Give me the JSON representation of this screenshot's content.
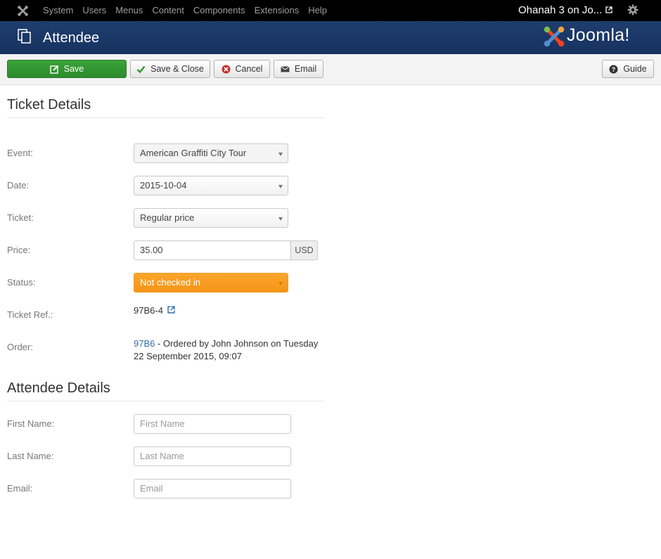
{
  "topnav": {
    "menu": [
      "System",
      "Users",
      "Menus",
      "Content",
      "Components",
      "Extensions",
      "Help"
    ],
    "site_name": "Ohanah 3 on Jo..."
  },
  "header": {
    "title": "Attendee",
    "brand": "Joomla!"
  },
  "toolbar": {
    "save": "Save",
    "save_close": "Save & Close",
    "cancel": "Cancel",
    "email": "Email",
    "guide": "Guide"
  },
  "ticket_details": {
    "heading": "Ticket Details",
    "event_label": "Event:",
    "event_value": "American Graffiti City Tour",
    "date_label": "Date:",
    "date_value": "2015-10-04",
    "ticket_label": "Ticket:",
    "ticket_value": "Regular price",
    "price_label": "Price:",
    "price_value": "35.00",
    "currency": "USD",
    "status_label": "Status:",
    "status_value": "Not checked in",
    "ticket_ref_label": "Ticket Ref.:",
    "ticket_ref_value": "97B6-4",
    "order_label": "Order:",
    "order_link": "97B6",
    "order_text": " - Ordered by John Johnson on Tuesday",
    "order_text_line2": "22 September 2015, 09:07"
  },
  "attendee_details": {
    "heading": "Attendee Details",
    "first_name_label": "First Name:",
    "first_name_placeholder": "First Name",
    "last_name_label": "Last Name:",
    "last_name_placeholder": "Last Name",
    "email_label": "Email:",
    "email_placeholder": "Email"
  },
  "colors": {
    "topnav_bg": "#000000",
    "header_bg": "#1a3867",
    "save_green": "#2f962f",
    "status_orange": "#f89f22",
    "link_blue": "#2f6fab"
  },
  "icons": {
    "topnav_logo": "joomla-icon",
    "site_external": "external-link-icon",
    "settings": "gear-icon",
    "header": "copy-icon",
    "save": "edit-icon",
    "save_close": "check-icon",
    "cancel": "cancel-circle-icon",
    "email": "envelope-icon",
    "guide": "question-circle-icon",
    "ticket_ref": "external-link-icon"
  }
}
